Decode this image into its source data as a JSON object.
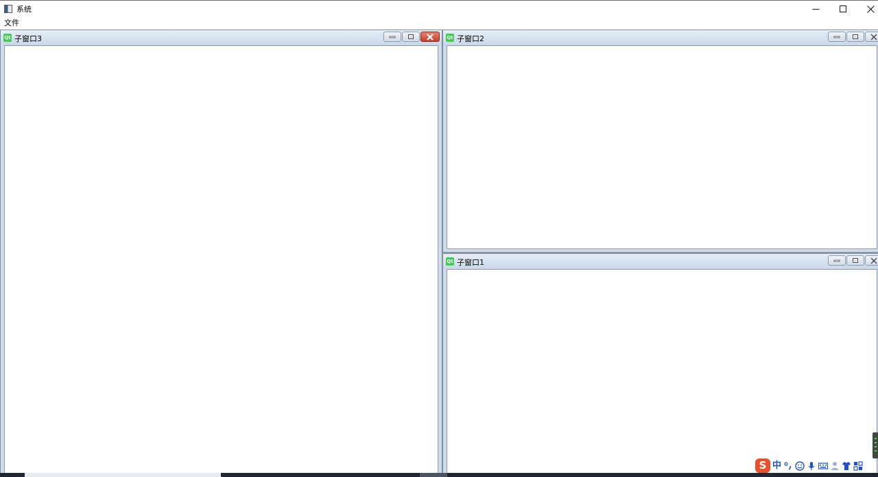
{
  "window": {
    "title": "系统",
    "caption_buttons": [
      "minimize",
      "maximize",
      "close"
    ]
  },
  "menubar": {
    "items": [
      {
        "label": "文件"
      }
    ]
  },
  "subwindows": [
    {
      "title": "子窗口3",
      "icon": "qt-icon",
      "active": true
    },
    {
      "title": "子窗口2",
      "icon": "qt-icon",
      "active": false
    },
    {
      "title": "子窗口1",
      "icon": "qt-icon",
      "active": false
    }
  ],
  "ime_toolbar": {
    "logo": "S",
    "mode_label": "中",
    "icons": [
      "punctuation-icon",
      "emoji-icon",
      "microphone-icon",
      "keyboard-icon",
      "user-icon",
      "skin-icon",
      "tools-icon"
    ]
  },
  "colors": {
    "mdi_background": "#a0a0a0",
    "subwindow_frame": "#cfdcea",
    "close_active": "#c7402c",
    "ime_logo": "#e8502b",
    "ime_accent": "#1a4fd6"
  }
}
